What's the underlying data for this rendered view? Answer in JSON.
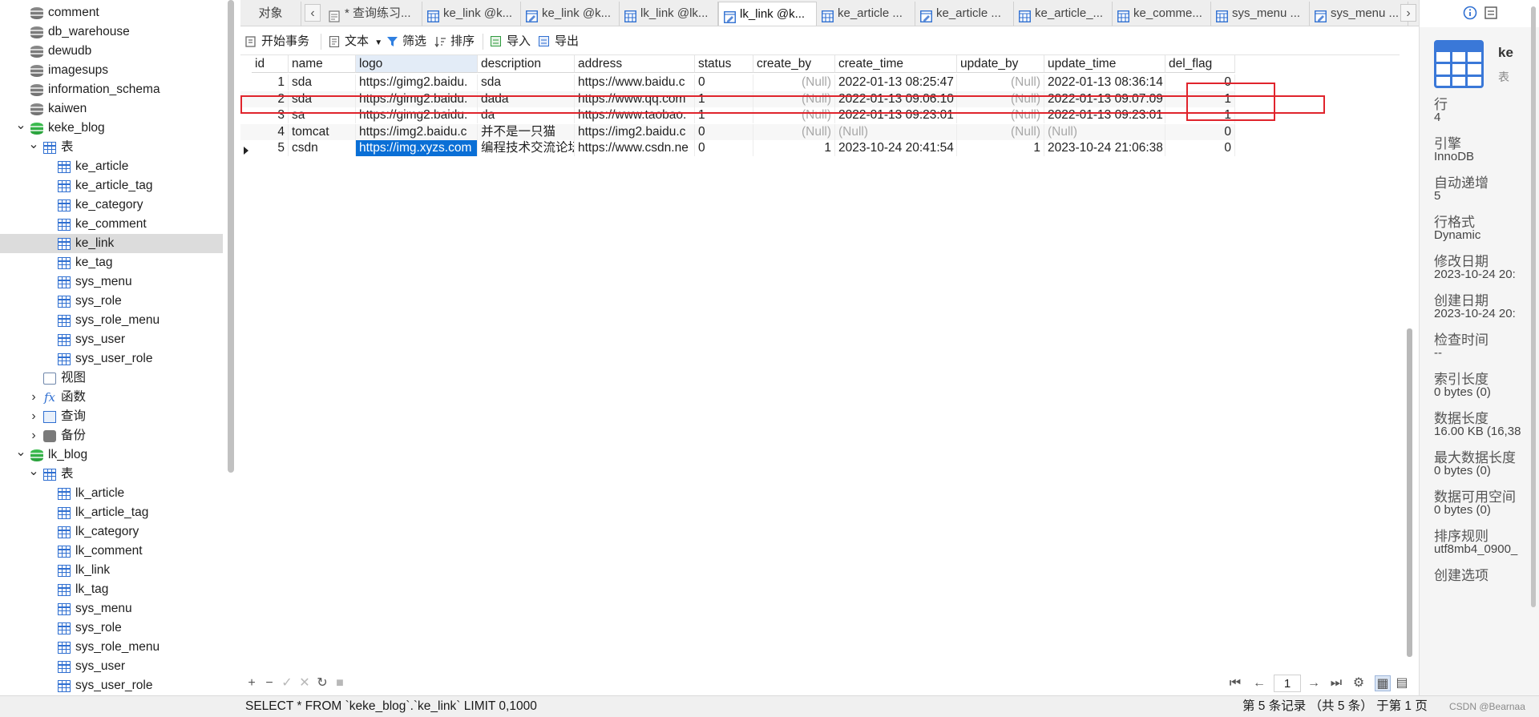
{
  "navigator": {
    "items": [
      {
        "label": "comment",
        "kind": "db",
        "level": 1
      },
      {
        "label": "db_warehouse",
        "kind": "db",
        "level": 1
      },
      {
        "label": "dewudb",
        "kind": "db",
        "level": 1
      },
      {
        "label": "imagesups",
        "kind": "db",
        "level": 1
      },
      {
        "label": "information_schema",
        "kind": "db",
        "level": 1
      },
      {
        "label": "kaiwen",
        "kind": "db",
        "level": 1
      },
      {
        "label": "keke_blog",
        "kind": "db-open",
        "level": 0,
        "expanded": true
      },
      {
        "label": "表",
        "kind": "tables",
        "level": 1,
        "expanded": true
      },
      {
        "label": "ke_article",
        "kind": "table",
        "level": 3
      },
      {
        "label": "ke_article_tag",
        "kind": "table",
        "level": 3
      },
      {
        "label": "ke_category",
        "kind": "table",
        "level": 3
      },
      {
        "label": "ke_comment",
        "kind": "table",
        "level": 3
      },
      {
        "label": "ke_link",
        "kind": "table",
        "level": 3,
        "selected": true
      },
      {
        "label": "ke_tag",
        "kind": "table",
        "level": 3
      },
      {
        "label": "sys_menu",
        "kind": "table",
        "level": 3
      },
      {
        "label": "sys_role",
        "kind": "table",
        "level": 3
      },
      {
        "label": "sys_role_menu",
        "kind": "table",
        "level": 3
      },
      {
        "label": "sys_user",
        "kind": "table",
        "level": 3
      },
      {
        "label": "sys_user_role",
        "kind": "table",
        "level": 3
      },
      {
        "label": "视图",
        "kind": "view",
        "level": 2
      },
      {
        "label": "函数",
        "kind": "func",
        "level": 1,
        "expanded": false
      },
      {
        "label": "查询",
        "kind": "query",
        "level": 1,
        "expanded": false
      },
      {
        "label": "备份",
        "kind": "backup",
        "level": 1,
        "expanded": false
      },
      {
        "label": "lk_blog",
        "kind": "db-open",
        "level": 0,
        "expanded": true
      },
      {
        "label": "表",
        "kind": "tables",
        "level": 1,
        "expanded": true
      },
      {
        "label": "lk_article",
        "kind": "table",
        "level": 3
      },
      {
        "label": "lk_article_tag",
        "kind": "table",
        "level": 3
      },
      {
        "label": "lk_category",
        "kind": "table",
        "level": 3
      },
      {
        "label": "lk_comment",
        "kind": "table",
        "level": 3
      },
      {
        "label": "lk_link",
        "kind": "table",
        "level": 3
      },
      {
        "label": "lk_tag",
        "kind": "table",
        "level": 3
      },
      {
        "label": "sys_menu",
        "kind": "table",
        "level": 3
      },
      {
        "label": "sys_role",
        "kind": "table",
        "level": 3
      },
      {
        "label": "sys_role_menu",
        "kind": "table",
        "level": 3
      },
      {
        "label": "sys_user",
        "kind": "table",
        "level": 3
      },
      {
        "label": "sys_user_role",
        "kind": "table",
        "level": 3
      }
    ]
  },
  "tabs": {
    "objects_label": "对象",
    "items": [
      {
        "label": "* 查询练习...",
        "icon": "query-icon"
      },
      {
        "label": "ke_link @k...",
        "icon": "table-icon"
      },
      {
        "label": "ke_link @k...",
        "icon": "design-icon"
      },
      {
        "label": "lk_link @lk...",
        "icon": "table-icon"
      },
      {
        "label": "lk_link @k...",
        "icon": "design-icon",
        "active": true
      },
      {
        "label": "ke_article ...",
        "icon": "table-icon"
      },
      {
        "label": "ke_article ...",
        "icon": "design-icon"
      },
      {
        "label": "ke_article_...",
        "icon": "table-icon"
      },
      {
        "label": "ke_comme...",
        "icon": "table-icon"
      },
      {
        "label": "sys_menu ...",
        "icon": "table-icon"
      },
      {
        "label": "sys_menu ...",
        "icon": "design-icon"
      }
    ]
  },
  "toolbar": {
    "begin_transaction": "开始事务",
    "text": "文本",
    "filter": "筛选",
    "sort": "排序",
    "import": "导入",
    "export": "导出"
  },
  "grid": {
    "columns": [
      "id",
      "name",
      "logo",
      "description",
      "address",
      "status",
      "create_by",
      "create_time",
      "update_by",
      "update_time",
      "del_flag"
    ],
    "selected_column": "logo",
    "rows": [
      [
        "1",
        "sda",
        "https://gimg2.baidu.",
        "sda",
        "https://www.baidu.c",
        "0",
        "(Null)",
        "2022-01-13 08:25:47",
        "(Null)",
        "2022-01-13 08:36:14",
        "0"
      ],
      [
        "2",
        "sda",
        "https://gimg2.baidu.",
        "dada",
        "https://www.qq.com",
        "1",
        "(Null)",
        "2022-01-13 09:06:10",
        "(Null)",
        "2022-01-13 09:07:09",
        "1"
      ],
      [
        "3",
        "sa",
        "https://gimg2.baidu.",
        "da",
        "https://www.taobao.",
        "1",
        "(Null)",
        "2022-01-13 09:23:01",
        "(Null)",
        "2022-01-13 09:23:01",
        "1"
      ],
      [
        "4",
        "tomcat",
        "https://img2.baidu.c",
        "并不是一只猫",
        "https://img2.baidu.c",
        "0",
        "(Null)",
        "(Null)",
        "(Null)",
        "(Null)",
        "0"
      ],
      [
        "5",
        "csdn",
        "https://img.xyzs.com",
        "编程技术交流论坛",
        "https://www.csdn.ne",
        "0",
        "1",
        "2023-10-24 20:41:54",
        "1",
        "2023-10-24 21:06:38",
        "0"
      ]
    ],
    "current_row": 4,
    "highlight_cell": [
      4,
      2
    ]
  },
  "pager": {
    "page": "1"
  },
  "statusbar": {
    "sql": "SELECT * FROM `keke_blog`.`ke_link` LIMIT 0,1000",
    "record_info": "第 5 条记录 （共 5 条） 于第 1 页",
    "watermark": "CSDN @Bearnaa"
  },
  "info_panel": {
    "name": "ke",
    "kind": "表",
    "properties": [
      {
        "label": "行",
        "value": "4"
      },
      {
        "label": "引擎",
        "value": "InnoDB"
      },
      {
        "label": "自动递增",
        "value": "5"
      },
      {
        "label": "行格式",
        "value": "Dynamic"
      },
      {
        "label": "修改日期",
        "value": "2023-10-24 20:"
      },
      {
        "label": "创建日期",
        "value": "2023-10-24 20:"
      },
      {
        "label": "检查时间",
        "value": "--"
      },
      {
        "label": "索引长度",
        "value": "0 bytes (0)"
      },
      {
        "label": "数据长度",
        "value": "16.00 KB (16,38"
      },
      {
        "label": "最大数据长度",
        "value": "0 bytes (0)"
      },
      {
        "label": "数据可用空间",
        "value": "0 bytes (0)"
      },
      {
        "label": "排序规则",
        "value": "utf8mb4_0900_"
      },
      {
        "label": "创建选项",
        "value": ""
      }
    ]
  },
  "colors": {
    "accent": "#0a6fd6",
    "annotation": "#e0242c",
    "db_open": "#2fae44",
    "table_icon": "#2f6fd1"
  }
}
